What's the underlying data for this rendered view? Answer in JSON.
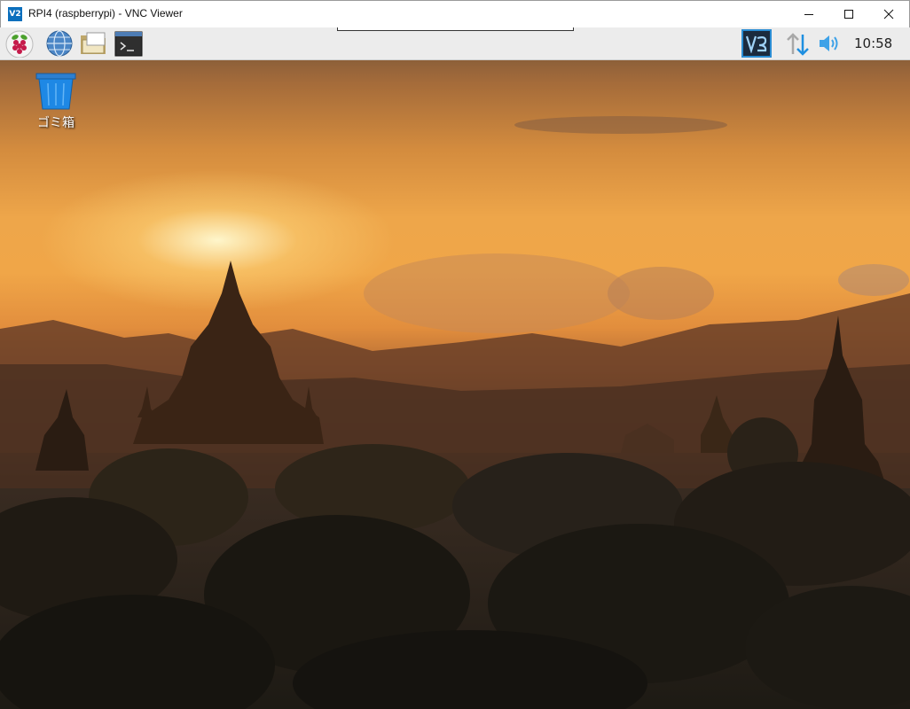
{
  "window": {
    "title": "RPI4 (raspberrypi) - VNC Viewer",
    "app_icon_text": "V2"
  },
  "panel": {
    "clock": "10:58",
    "accent": "#2a8dd4"
  },
  "desktop": {
    "trash_label": "ゴミ箱"
  }
}
